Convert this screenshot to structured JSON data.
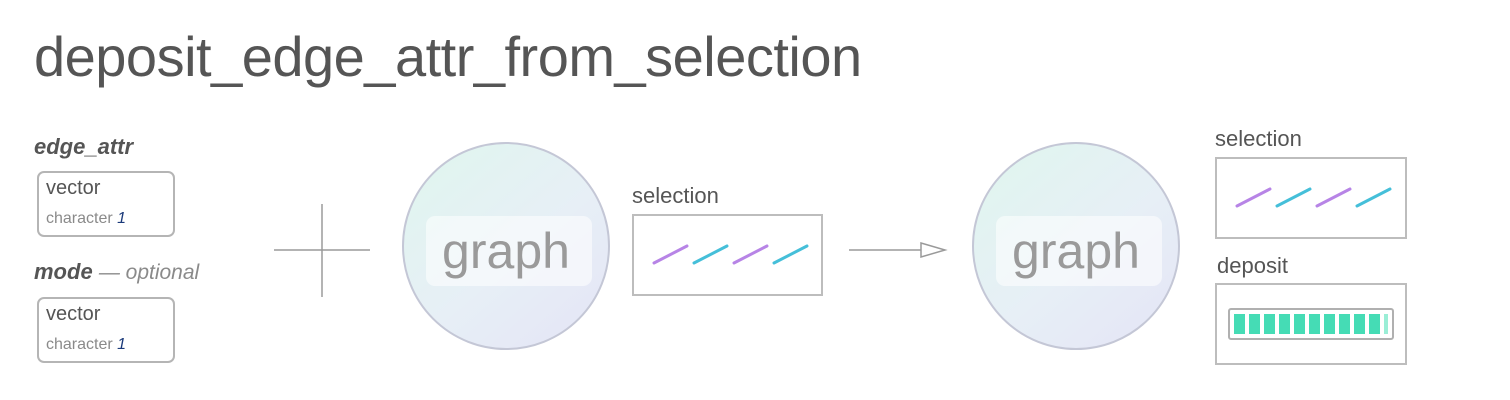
{
  "title": "deposit_edge_attr_from_selection",
  "params": [
    {
      "name": "edge_attr",
      "optional_note": "",
      "type": "vector",
      "subtype": "character",
      "length": "1"
    },
    {
      "name": "mode",
      "optional_note": "— optional",
      "type": "vector",
      "subtype": "character",
      "length": "1"
    }
  ],
  "input": {
    "graph_label": "graph",
    "selection_label": "selection"
  },
  "output": {
    "graph_label": "graph",
    "selection_label": "selection",
    "deposit_label": "deposit"
  },
  "colors": {
    "purple": "#b784e6",
    "blue": "#45bfd9",
    "teal": "#45dcb5",
    "text": "#555555"
  },
  "icons": {
    "plus": "plus-icon",
    "arrow": "arrow-right-icon"
  }
}
